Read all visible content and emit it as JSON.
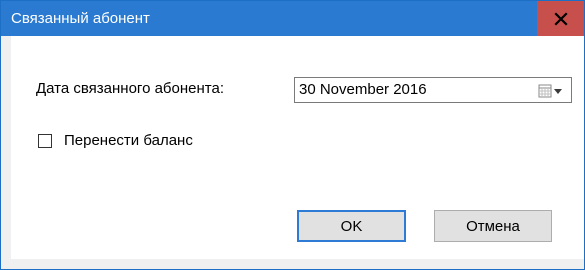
{
  "window": {
    "title": "Связанный абонент",
    "close_icon": "close-icon",
    "colors": {
      "titlebar": "#2b7ad1",
      "close": "#c7504d",
      "accent_border": "#2e7bd6"
    }
  },
  "form": {
    "date_label": "Дата связанного абонента:",
    "date_value": "30 November 2016",
    "date_picker_icon": "calendar-icon",
    "dropdown_icon": "chevron-down-icon",
    "transfer_balance_label": "Перенести баланс",
    "transfer_balance_checked": false
  },
  "buttons": {
    "ok_label": "OK",
    "cancel_label": "Отмена"
  }
}
